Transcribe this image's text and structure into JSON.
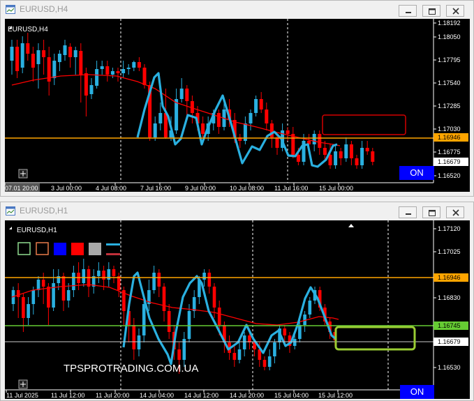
{
  "windows": [
    {
      "title": "EURUSD,H4",
      "chart_label": "EURUSD,H4",
      "on_label": "ON",
      "price_labels": [
        "1.18192",
        "1.18050",
        "1.17795",
        "1.17540",
        "1.17285",
        "1.17030",
        "1.16946",
        "1.16775",
        "1.16679",
        "1.16520"
      ],
      "time_labels": [
        "07.01 20:00",
        "3 Jul 00:00",
        "4 Jul 08:00",
        "7 Jul 16:00",
        "9 Jul 00:00",
        "10 Jul 08:00",
        "11 Jul 16:00",
        "15 Jul 00:00"
      ],
      "current_price": "1.16679",
      "level_price": "1.16946",
      "level_color": "#ffa500",
      "zone_color": "#d40000"
    },
    {
      "title": "EURUSD,H1",
      "chart_label": "EURUSD,H1",
      "on_label": "ON",
      "watermark": "TPSPROTRADING.COM.UA",
      "price_labels": [
        "1.17120",
        "1.17025",
        "1.16925",
        "1.16830",
        "1.16730",
        "1.16630",
        "1.16530"
      ],
      "level_price": "1.16946",
      "green_price": "1.16745",
      "current_price": "1.16679",
      "time_labels": [
        "11 Jul 2025",
        "11 Jul 12:00",
        "11 Jul 20:00",
        "14 Jul 04:00",
        "14 Jul 12:00",
        "14 Jul 20:00",
        "15 Jul 04:00",
        "15 Jul 12:00"
      ],
      "level_color": "#ffa500",
      "green_color": "#66cc33",
      "zone_color": "#99cc33",
      "toolbar": [
        "outline-green",
        "outline-orange",
        "fill-blue",
        "fill-red",
        "fill-gray",
        "lines"
      ]
    }
  ],
  "colors": {
    "bull": "#2ab0e0",
    "bear": "#ff0000",
    "ma": "#ff0000",
    "zigzag": "#2ab0e0",
    "on_button": "#0000ff"
  }
}
